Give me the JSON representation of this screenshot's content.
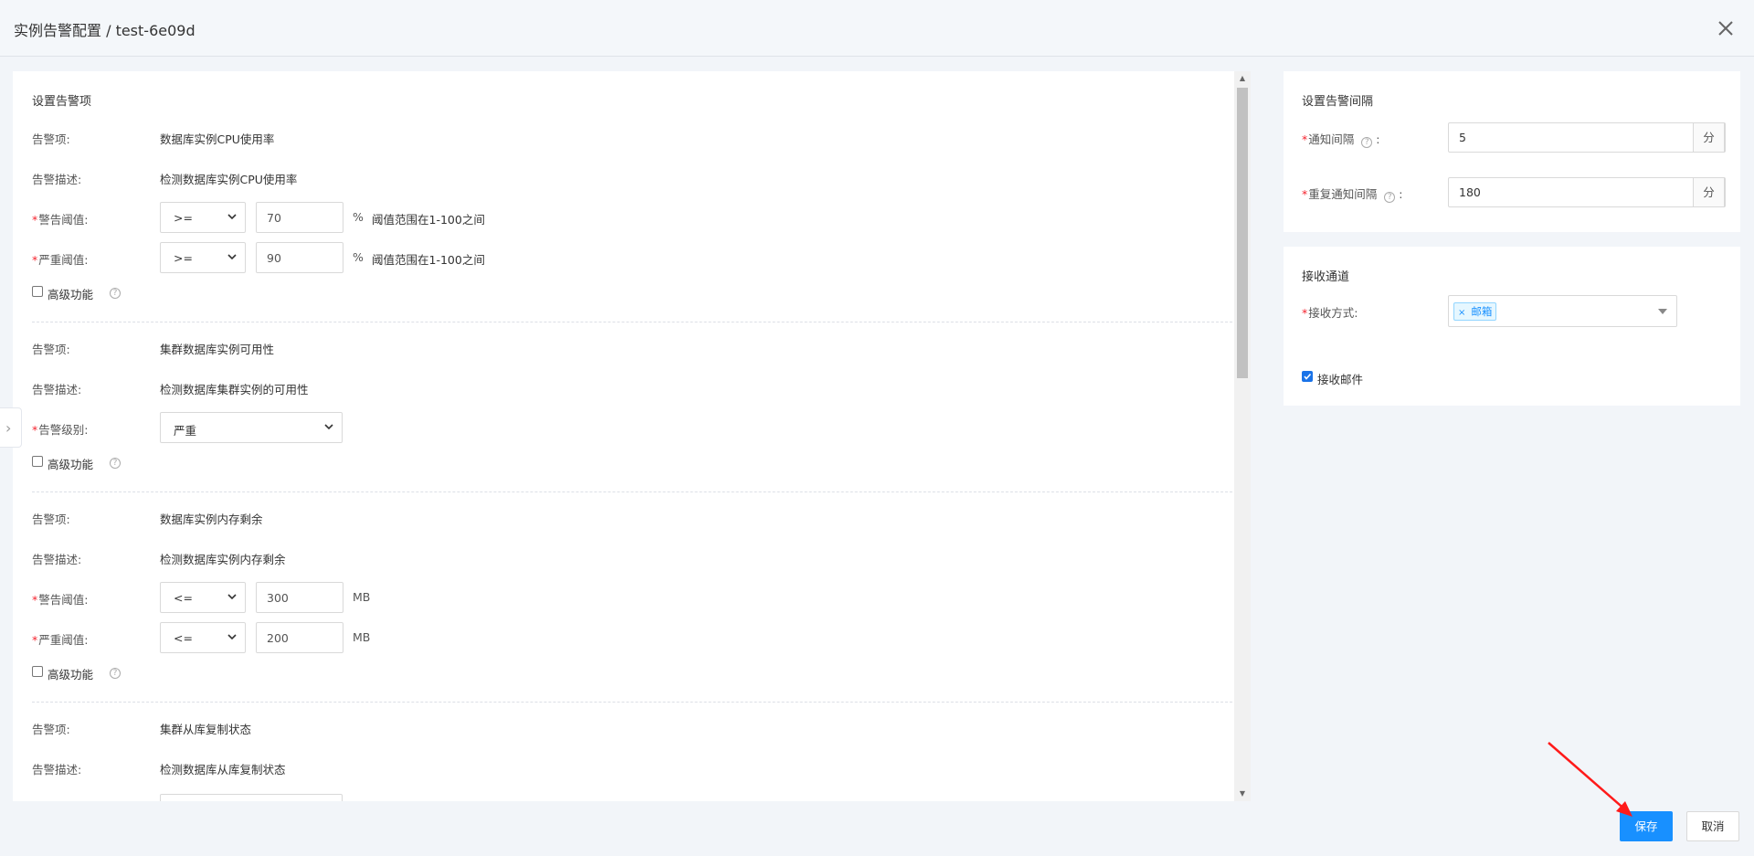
{
  "window": {
    "title": "实例告警配置 / test-6e09d"
  },
  "left": {
    "section_title": "设置告警项",
    "groups": [
      {
        "item_label": "告警项:",
        "item_value": "数据库实例CPU使用率",
        "desc_label": "告警描述:",
        "desc_value": "检测数据库实例CPU使用率",
        "warn": {
          "label": "警告阈值:",
          "op": ">=",
          "value": "70",
          "unit": "%",
          "hint": "阈值范围在1-100之间"
        },
        "crit": {
          "label": "严重阈值:",
          "op": ">=",
          "value": "90",
          "unit": "%",
          "hint": "阈值范围在1-100之间"
        },
        "advanced": "高级功能"
      },
      {
        "item_label": "告警项:",
        "item_value": "集群数据库实例可用性",
        "desc_label": "告警描述:",
        "desc_value": "检测数据库集群实例的可用性",
        "level": {
          "label": "告警级别:",
          "value": "严重"
        },
        "advanced": "高级功能"
      },
      {
        "item_label": "告警项:",
        "item_value": "数据库实例内存剩余",
        "desc_label": "告警描述:",
        "desc_value": "检测数据库实例内存剩余",
        "warn": {
          "label": "警告阈值:",
          "op": "<=",
          "value": "300",
          "unit": "MB"
        },
        "crit": {
          "label": "严重阈值:",
          "op": "<=",
          "value": "200",
          "unit": "MB"
        },
        "advanced": "高级功能"
      },
      {
        "item_label": "告警项:",
        "item_value": "集群从库复制状态",
        "desc_label": "告警描述:",
        "desc_value": "检测数据库从库复制状态"
      }
    ]
  },
  "interval": {
    "title": "设置告警间隔",
    "notify": {
      "label": "通知间隔",
      "value": "5",
      "unit": "分"
    },
    "repeat": {
      "label": "重复通知间隔",
      "value": "180",
      "unit": "分"
    },
    "colon": ":"
  },
  "channel": {
    "title": "接收通道",
    "method_label": "接收方式:",
    "tags": [
      "邮箱"
    ],
    "tag_remove": "×",
    "email_checkbox": "接收邮件"
  },
  "footer": {
    "save": "保存",
    "cancel": "取消"
  },
  "icons": {
    "close": "close-icon",
    "help": "question-circle-icon",
    "expand": "chevron-right-icon"
  },
  "colors": {
    "primary": "#1890ff",
    "required": "#f5222d",
    "annotation": "#ff1a1a"
  },
  "symbols": {
    "req": "*",
    "q": "?",
    "chev": "›",
    "up": "▲",
    "down": "▼"
  }
}
